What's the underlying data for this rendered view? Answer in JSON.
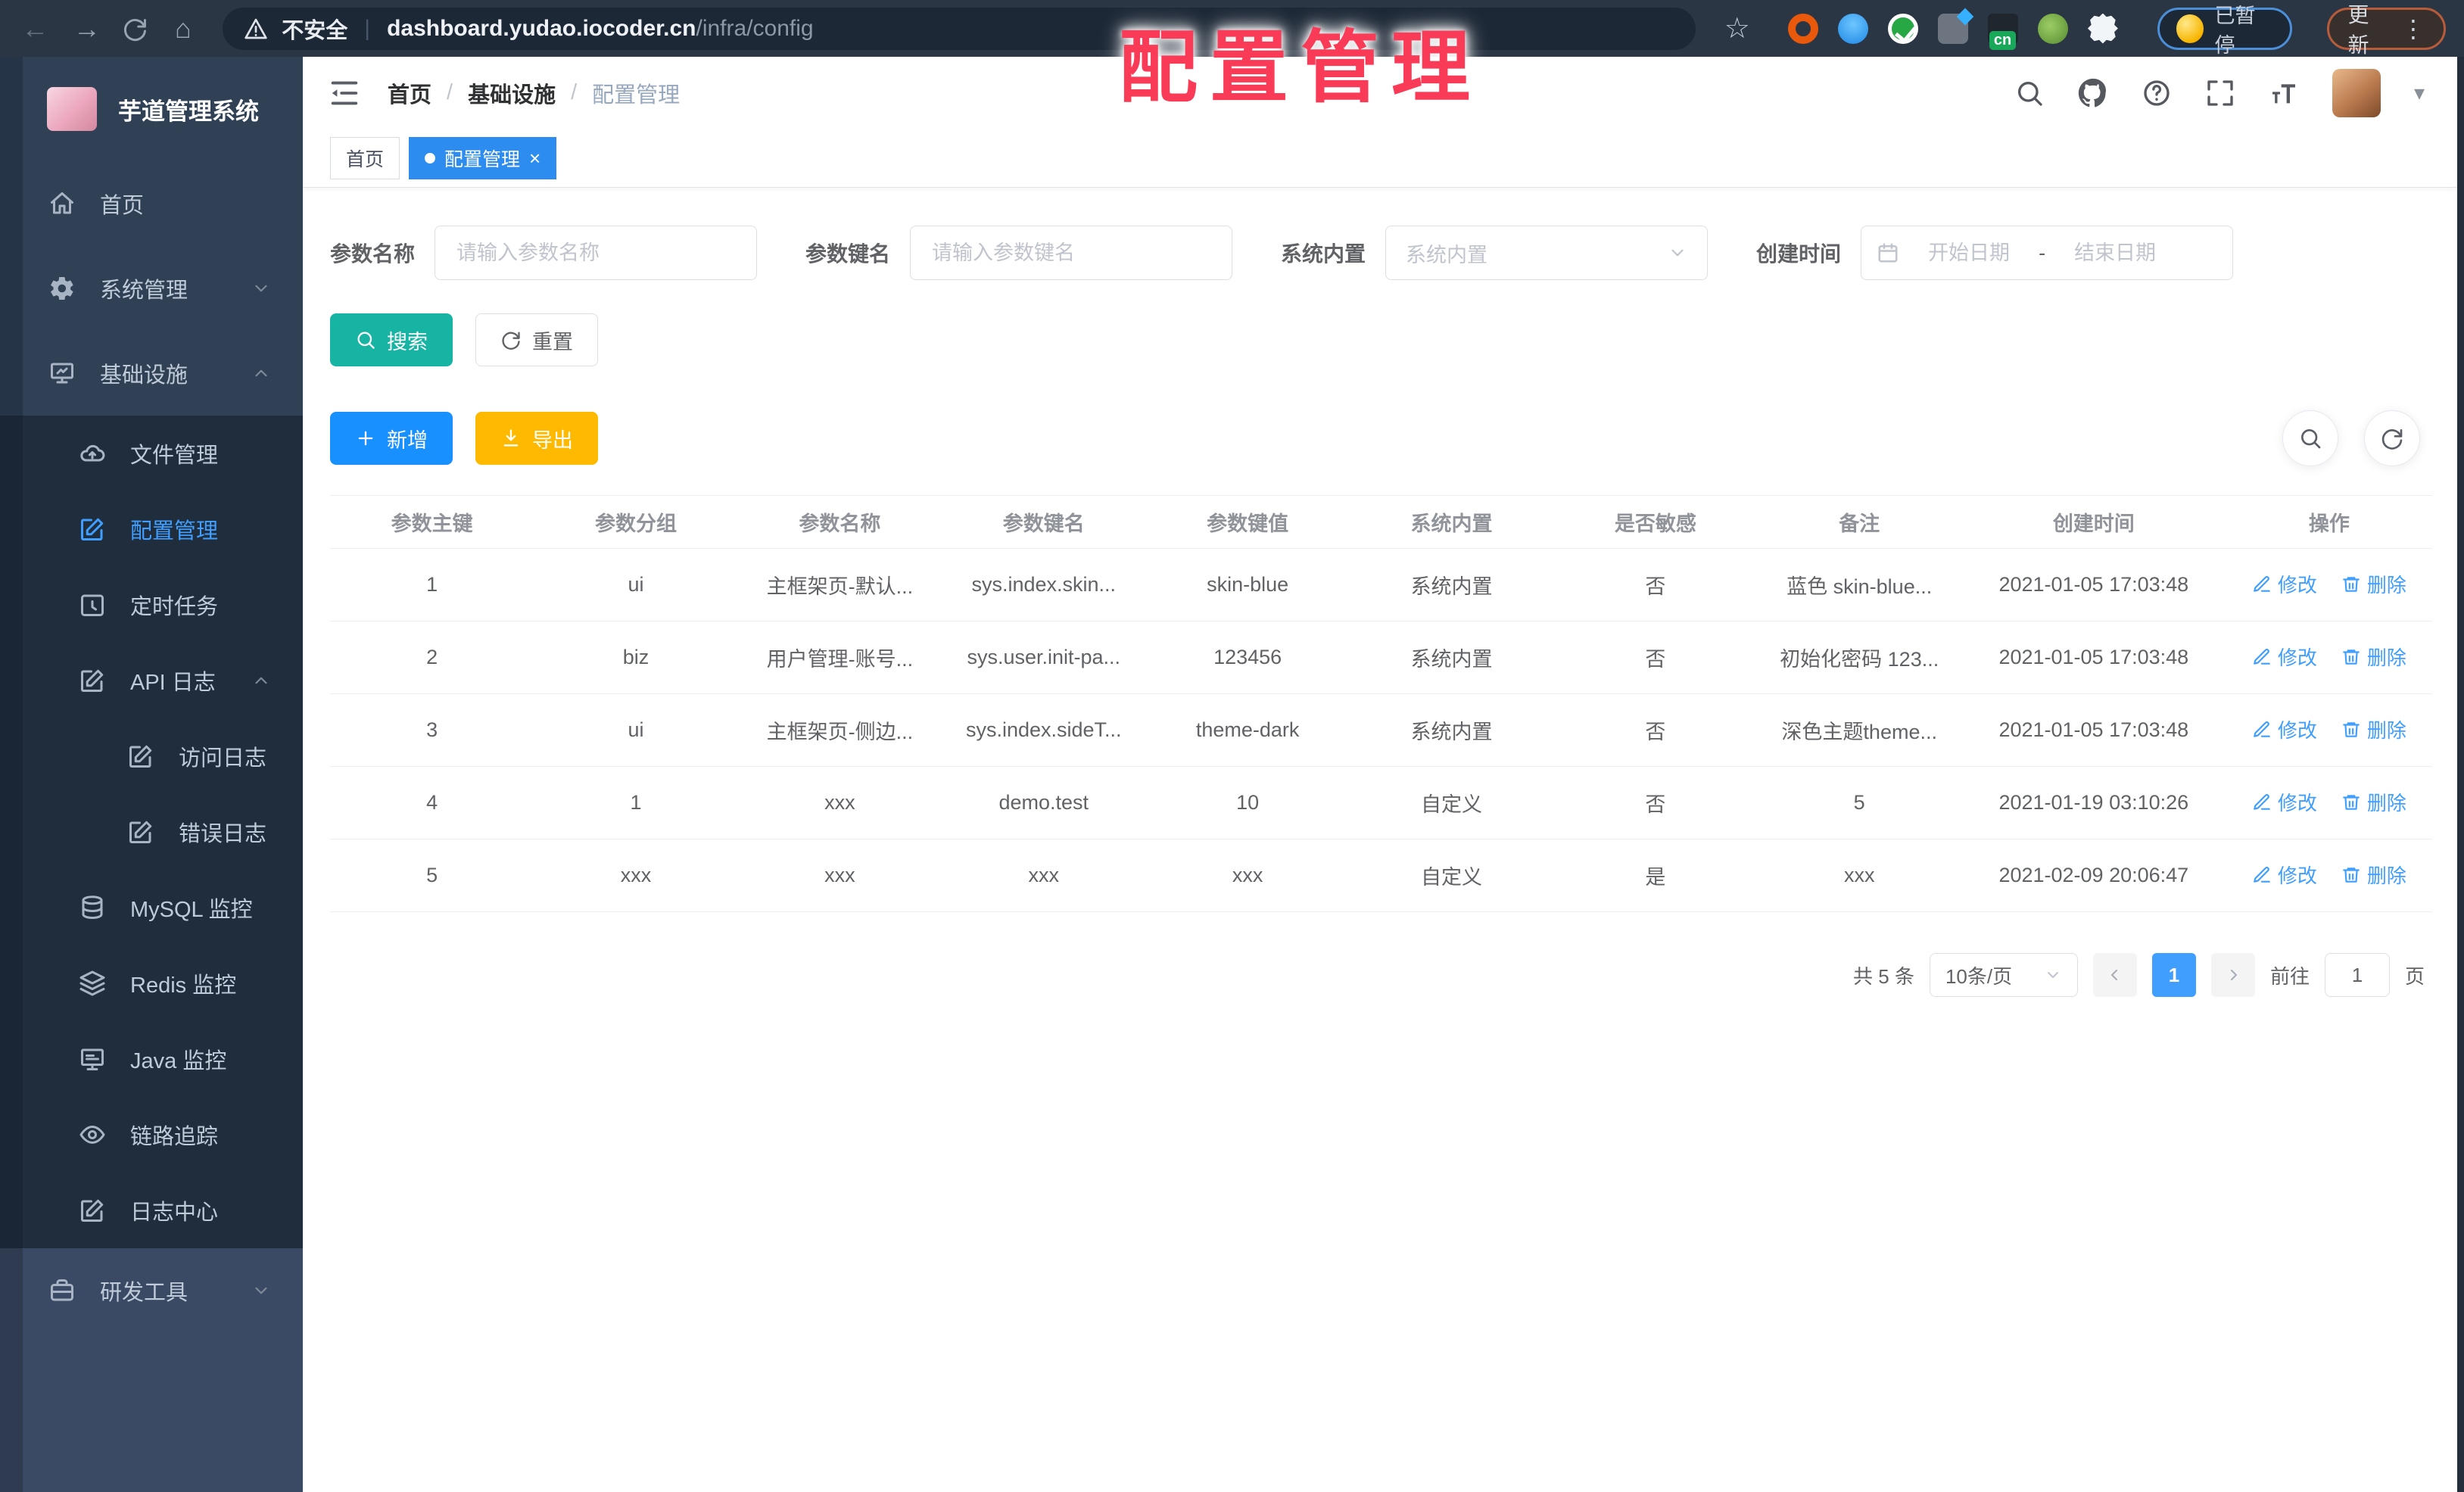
{
  "browser": {
    "security_label": "不安全",
    "url_host": "dashboard.yudao.iocoder.cn",
    "url_path": "/infra/config",
    "paused_badge": "已暂停",
    "update_button": "更新"
  },
  "glyphs": {
    "back": "←",
    "forward": "→",
    "home": "⌂",
    "star": "☆",
    "pipe": "|",
    "more": "⋮",
    "caret": "▾",
    "close": "×"
  },
  "watermark": "配置管理",
  "sidebar": {
    "app_title": "芋道管理系统",
    "items": [
      {
        "label": "首页"
      },
      {
        "label": "系统管理"
      },
      {
        "label": "基础设施"
      },
      {
        "label": "文件管理"
      },
      {
        "label": "配置管理"
      },
      {
        "label": "定时任务"
      },
      {
        "label": "API 日志"
      },
      {
        "label": "访问日志"
      },
      {
        "label": "错误日志"
      },
      {
        "label": "MySQL 监控"
      },
      {
        "label": "Redis 监控"
      },
      {
        "label": "Java 监控"
      },
      {
        "label": "链路追踪"
      },
      {
        "label": "日志中心"
      },
      {
        "label": "研发工具"
      }
    ]
  },
  "header": {
    "breadcrumb": [
      "首页",
      "基础设施",
      "配置管理"
    ]
  },
  "tabs": [
    {
      "label": "首页"
    },
    {
      "label": "配置管理"
    }
  ],
  "filters": {
    "name_label": "参数名称",
    "name_placeholder": "请输入参数名称",
    "key_label": "参数键名",
    "key_placeholder": "请输入参数键名",
    "type_label": "系统内置",
    "type_placeholder": "系统内置",
    "date_label": "创建时间",
    "date_start_placeholder": "开始日期",
    "date_separator": "-",
    "date_end_placeholder": "结束日期",
    "search_button": "搜索",
    "reset_button": "重置"
  },
  "toolbar": {
    "add_button": "新增",
    "export_button": "导出"
  },
  "table": {
    "columns": [
      "参数主键",
      "参数分组",
      "参数名称",
      "参数键名",
      "参数键值",
      "系统内置",
      "是否敏感",
      "备注",
      "创建时间",
      "操作"
    ],
    "edit_label": "修改",
    "delete_label": "删除",
    "rows": [
      {
        "id": "1",
        "group": "ui",
        "name": "主框架页-默认...",
        "key": "sys.index.skin...",
        "value": "skin-blue",
        "type": "系统内置",
        "sensitive": "否",
        "remark": "蓝色 skin-blue...",
        "created": "2021-01-05 17:03:48"
      },
      {
        "id": "2",
        "group": "biz",
        "name": "用户管理-账号...",
        "key": "sys.user.init-pa...",
        "value": "123456",
        "type": "系统内置",
        "sensitive": "否",
        "remark": "初始化密码 123...",
        "created": "2021-01-05 17:03:48"
      },
      {
        "id": "3",
        "group": "ui",
        "name": "主框架页-侧边...",
        "key": "sys.index.sideT...",
        "value": "theme-dark",
        "type": "系统内置",
        "sensitive": "否",
        "remark": "深色主题theme...",
        "created": "2021-01-05 17:03:48"
      },
      {
        "id": "4",
        "group": "1",
        "name": "xxx",
        "key": "demo.test",
        "value": "10",
        "type": "自定义",
        "sensitive": "否",
        "remark": "5",
        "created": "2021-01-19 03:10:26"
      },
      {
        "id": "5",
        "group": "xxx",
        "name": "xxx",
        "key": "xxx",
        "value": "xxx",
        "type": "自定义",
        "sensitive": "是",
        "remark": "xxx",
        "created": "2021-02-09 20:06:47"
      }
    ]
  },
  "pagination": {
    "total": "共 5 条",
    "page_size": "10条/页",
    "current_page": "1",
    "goto_label": "前往",
    "goto_value": "1",
    "page_unit": "页"
  },
  "icons": [
    "back-icon",
    "forward-icon",
    "reload-icon",
    "home-icon",
    "warning-icon",
    "star-icon",
    "extension-icons",
    "more-vertical-icon",
    "hamburger-icon",
    "search-icon",
    "github-icon",
    "help-icon",
    "fullscreen-icon",
    "font-size-icon",
    "avatar",
    "chevron-down-icon",
    "chevron-up-icon",
    "home-menu-icon",
    "gear-icon",
    "monitor-icon",
    "cloud-upload-icon",
    "edit-square-icon",
    "clock-icon",
    "database-icon",
    "layers-icon",
    "eye-icon",
    "briefcase-icon",
    "calendar-icon",
    "refresh-icon",
    "plus-icon",
    "download-icon",
    "magnifier-icon",
    "pencil-icon",
    "trash-icon"
  ]
}
